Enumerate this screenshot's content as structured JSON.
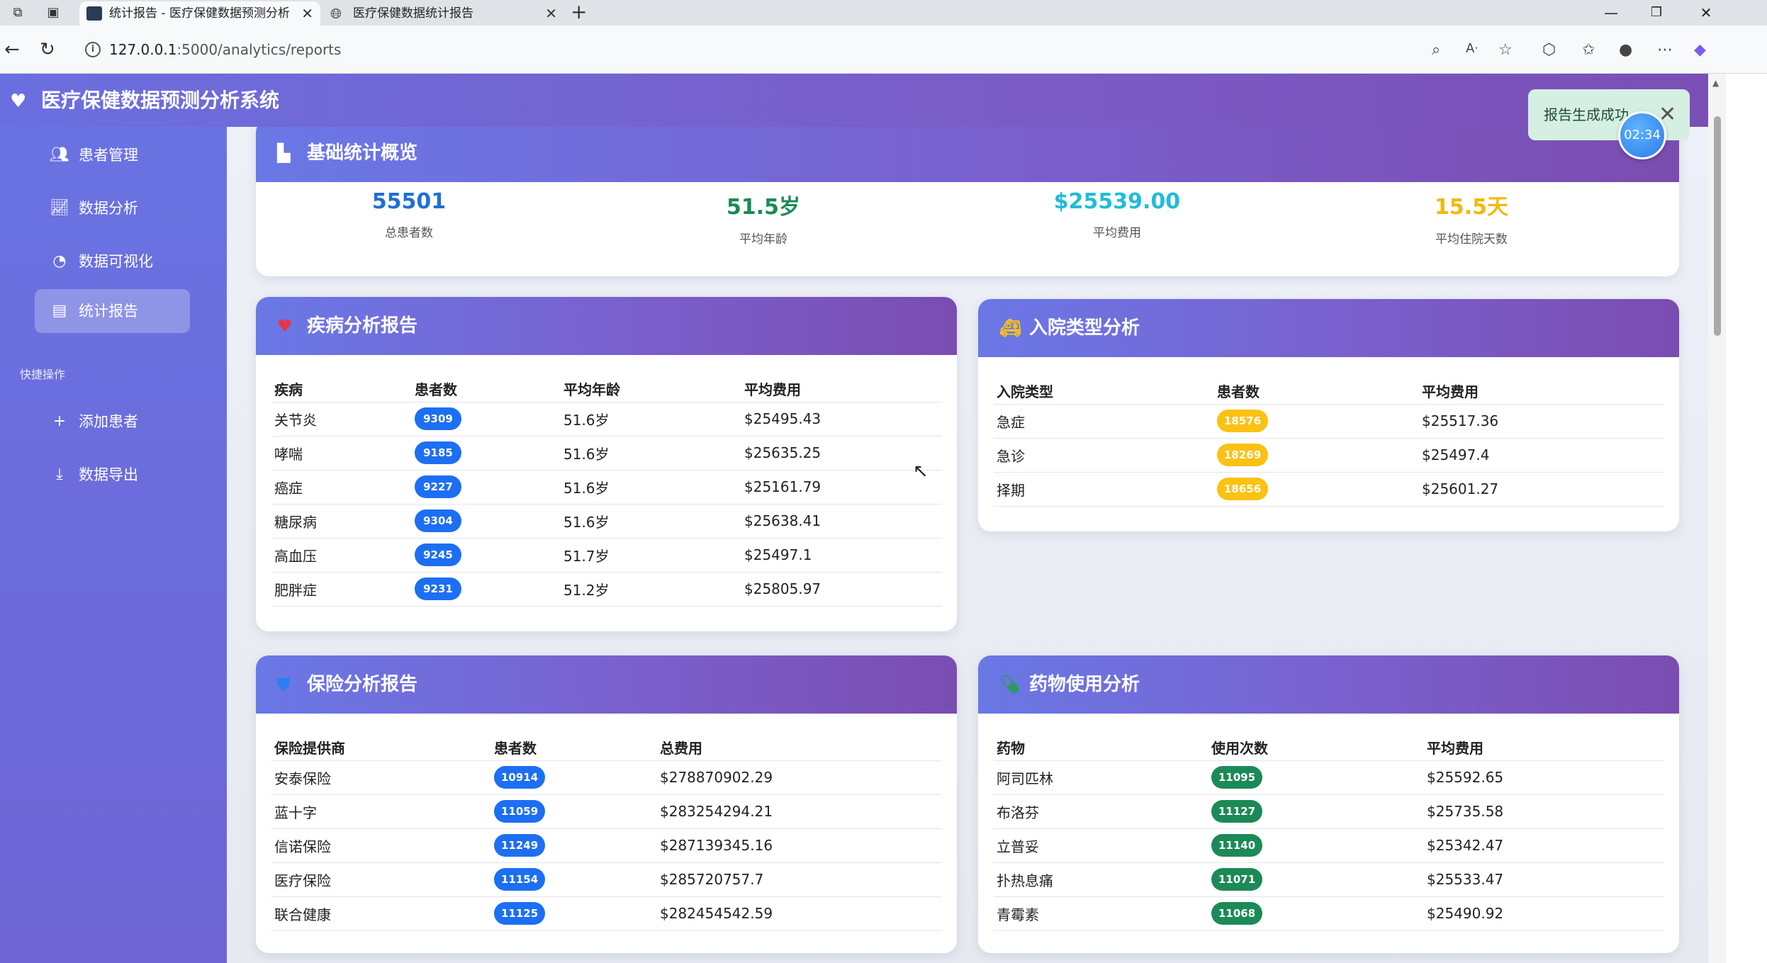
{
  "browser": {
    "tabs": [
      {
        "title": "统计报告 - 医疗保健数据预测分析",
        "active": true
      },
      {
        "title": "医疗保健数据统计报告",
        "active": false
      }
    ],
    "url_host": "127.0.0.1",
    "url_path": ":5000/analytics/reports"
  },
  "app": {
    "title": "医疗保健数据预测分析系统"
  },
  "sidebar": {
    "items": [
      {
        "label": "患者管理",
        "icon": "users-icon"
      },
      {
        "label": "数据分析",
        "icon": "chart-line-icon"
      },
      {
        "label": "数据可视化",
        "icon": "pie-chart-icon"
      },
      {
        "label": "统计报告",
        "icon": "file-icon",
        "active": true
      }
    ],
    "quick_heading": "快捷操作",
    "quick_items": [
      {
        "label": "添加患者",
        "icon": "plus-icon"
      },
      {
        "label": "数据导出",
        "icon": "download-icon"
      }
    ]
  },
  "overview": {
    "title": "基础统计概览",
    "stats": [
      {
        "value": "55501",
        "label": "总患者数",
        "color": "#1f6fd6"
      },
      {
        "value": "51.5岁",
        "label": "平均年龄",
        "color": "#1b8a55"
      },
      {
        "value": "$25539.00",
        "label": "平均费用",
        "color": "#21bcd8"
      },
      {
        "value": "15.5天",
        "label": "平均住院天数",
        "color": "#f3b90c"
      }
    ]
  },
  "disease": {
    "title": "疾病分析报告",
    "headers": [
      "疾病",
      "患者数",
      "平均年龄",
      "平均费用"
    ],
    "rows": [
      [
        "关节炎",
        "9309",
        "51.6岁",
        "$25495.43"
      ],
      [
        "哮喘",
        "9185",
        "51.6岁",
        "$25635.25"
      ],
      [
        "癌症",
        "9227",
        "51.6岁",
        "$25161.79"
      ],
      [
        "糖尿病",
        "9304",
        "51.6岁",
        "$25638.41"
      ],
      [
        "高血压",
        "9245",
        "51.7岁",
        "$25497.1"
      ],
      [
        "肥胖症",
        "9231",
        "51.2岁",
        "$25805.97"
      ]
    ]
  },
  "admission": {
    "title": "入院类型分析",
    "headers": [
      "入院类型",
      "患者数",
      "平均费用"
    ],
    "rows": [
      [
        "急症",
        "18576",
        "$25517.36"
      ],
      [
        "急诊",
        "18269",
        "$25497.4"
      ],
      [
        "择期",
        "18656",
        "$25601.27"
      ]
    ]
  },
  "insurance": {
    "title": "保险分析报告",
    "headers": [
      "保险提供商",
      "患者数",
      "总费用"
    ],
    "rows": [
      [
        "安泰保险",
        "10914",
        "$278870902.29"
      ],
      [
        "蓝十字",
        "11059",
        "$283254294.21"
      ],
      [
        "信诺保险",
        "11249",
        "$287139345.16"
      ],
      [
        "医疗保险",
        "11154",
        "$285720757.7"
      ],
      [
        "联合健康",
        "11125",
        "$282454542.59"
      ]
    ]
  },
  "medication": {
    "title": "药物使用分析",
    "headers": [
      "药物",
      "使用次数",
      "平均费用"
    ],
    "rows": [
      [
        "阿司匹林",
        "11095",
        "$25592.65"
      ],
      [
        "布洛芬",
        "11127",
        "$25735.58"
      ],
      [
        "立普妥",
        "11140",
        "$25342.47"
      ],
      [
        "扑热息痛",
        "11071",
        "$25533.47"
      ],
      [
        "青霉素",
        "11068",
        "$25490.92"
      ]
    ]
  },
  "toast": {
    "message": "报告生成成功",
    "timer": "02:34"
  }
}
